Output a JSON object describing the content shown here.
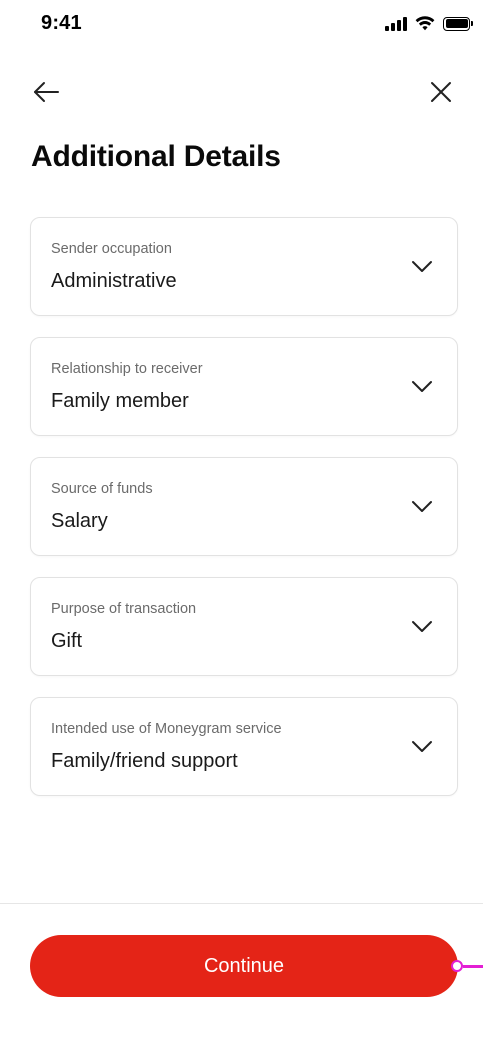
{
  "status_bar": {
    "time": "9:41"
  },
  "page": {
    "title": "Additional Details"
  },
  "fields": [
    {
      "label": "Sender occupation",
      "value": "Administrative"
    },
    {
      "label": "Relationship to receiver",
      "value": "Family member"
    },
    {
      "label": "Source of funds",
      "value": "Salary"
    },
    {
      "label": "Purpose of transaction",
      "value": "Gift"
    },
    {
      "label": "Intended use of Moneygram service",
      "value": "Family/friend support"
    }
  ],
  "footer": {
    "continue_label": "Continue"
  },
  "icons": {
    "back": "arrow-left-icon",
    "close": "close-icon",
    "dropdown": "chevron-down-icon"
  },
  "colors": {
    "accent": "#e42417",
    "selection_handle": "#e31fd4"
  }
}
